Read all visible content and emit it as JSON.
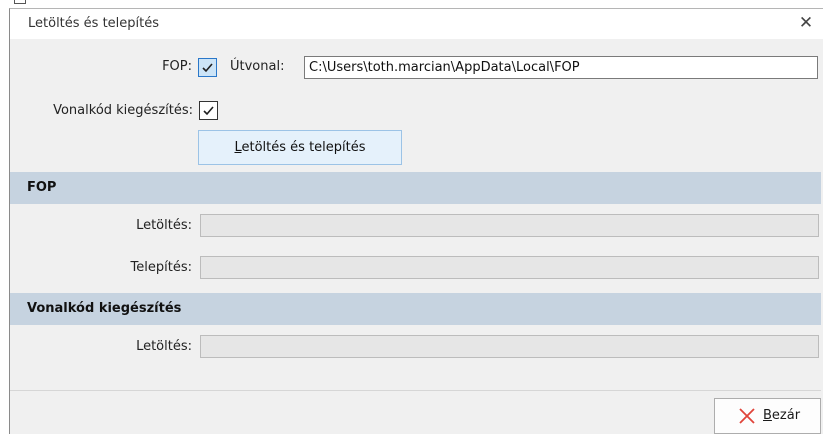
{
  "dialog": {
    "title": "Letöltés és telepítés",
    "close_symbol": "✕"
  },
  "options": {
    "fop_label": "FOP:",
    "fop_checked": true,
    "path_label": "Útvonal:",
    "path_value": "C:\\Users\\toth.marcian\\AppData\\Local\\FOP",
    "barcode_label": "Vonalkód kiegészítés:",
    "barcode_checked": true
  },
  "action_button": {
    "accesskey": "L",
    "rest": "etöltés és telepítés"
  },
  "fop_section": {
    "title": "FOP",
    "download_label": "Letöltés:",
    "download_progress": 0,
    "install_label": "Telepítés:",
    "install_progress": 0
  },
  "barcode_section": {
    "title": "Vonalkód kiegészítés",
    "download_label": "Letöltés:",
    "download_progress": 0
  },
  "footer": {
    "close_accesskey": "B",
    "close_rest": "ezár",
    "close_icon": "close-x-icon",
    "close_icon_color": "#e0443a"
  },
  "colors": {
    "section_header": "#c6d3e0",
    "check_blue": "#2a77c9"
  }
}
